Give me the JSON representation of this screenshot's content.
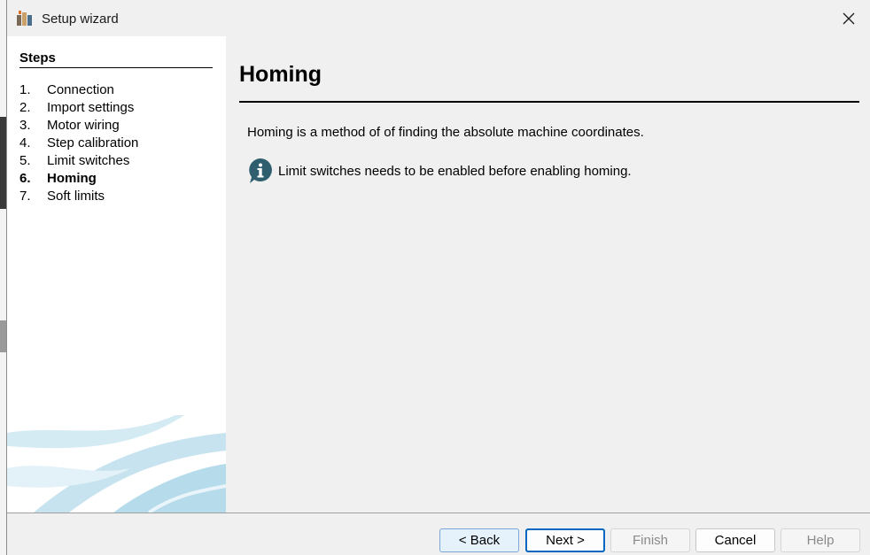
{
  "window": {
    "title": "Setup wizard"
  },
  "steps": {
    "heading": "Steps",
    "items": [
      {
        "num": "1.",
        "label": "Connection",
        "current": false
      },
      {
        "num": "2.",
        "label": "Import settings",
        "current": false
      },
      {
        "num": "3.",
        "label": "Motor wiring",
        "current": false
      },
      {
        "num": "4.",
        "label": "Step calibration",
        "current": false
      },
      {
        "num": "5.",
        "label": "Limit switches",
        "current": false
      },
      {
        "num": "6.",
        "label": "Homing",
        "current": true
      },
      {
        "num": "7.",
        "label": "Soft limits",
        "current": false
      }
    ]
  },
  "page": {
    "title": "Homing",
    "description": "Homing is a method of of finding the absolute machine coordinates.",
    "info": "Limit switches needs to be enabled before enabling homing."
  },
  "buttons": {
    "back": "< Back",
    "next": "Next >",
    "finish": "Finish",
    "cancel": "Cancel",
    "help": "Help"
  },
  "colors": {
    "info_icon": "#2f5f6e",
    "next_border": "#0067c0",
    "swoosh": "#bfe0ee"
  }
}
